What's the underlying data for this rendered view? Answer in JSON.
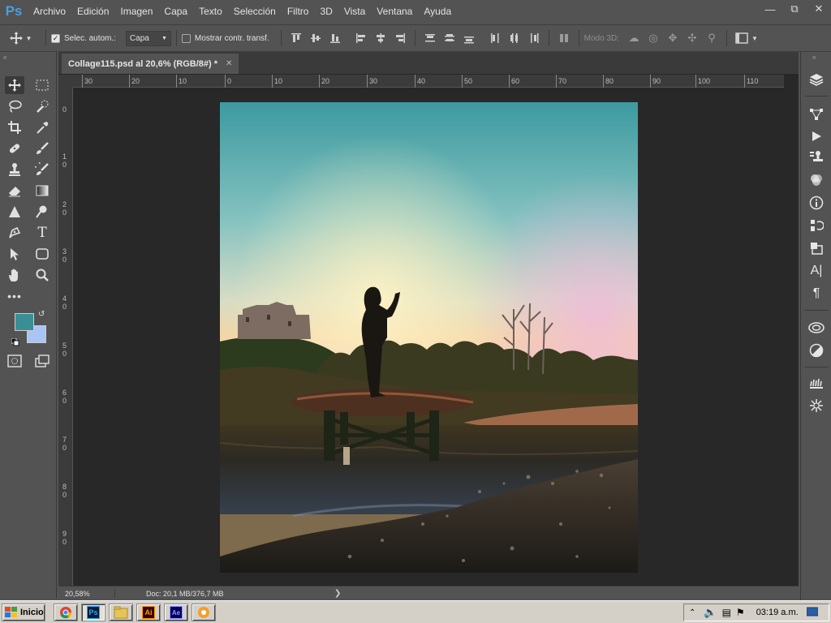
{
  "app": {
    "logo": "Ps"
  },
  "menu": [
    "Archivo",
    "Edición",
    "Imagen",
    "Capa",
    "Texto",
    "Selección",
    "Filtro",
    "3D",
    "Vista",
    "Ventana",
    "Ayuda"
  ],
  "options": {
    "auto_select_label": "Selec. autom.:",
    "auto_select_value": "Capa",
    "show_transform_label": "Mostrar contr. transf.",
    "mode_3d_label": "Modo 3D:"
  },
  "document": {
    "tab_title": "Collage115.psd al 20,6% (RGB/8#)",
    "tab_modified": "*",
    "zoom": "20,58%",
    "doc_info": "Doc: 20,1 MB/376,7 MB"
  },
  "ruler": {
    "top_ticks": [
      "30",
      "20",
      "10",
      "0",
      "10",
      "20",
      "30",
      "40",
      "50",
      "60",
      "70",
      "80",
      "90",
      "100",
      "110"
    ],
    "left_ticks": [
      "0",
      "1\n0",
      "2\n0",
      "3\n0",
      "4\n0",
      "5\n0",
      "6\n0",
      "7\n0",
      "8\n0",
      "9\n0"
    ]
  },
  "colors": {
    "foreground": "#3a8f95",
    "background": "#a9c4f5",
    "accent": "#4a9fe0"
  },
  "taskbar": {
    "start_label": "Inicio",
    "clock": "03:19 a.m."
  }
}
